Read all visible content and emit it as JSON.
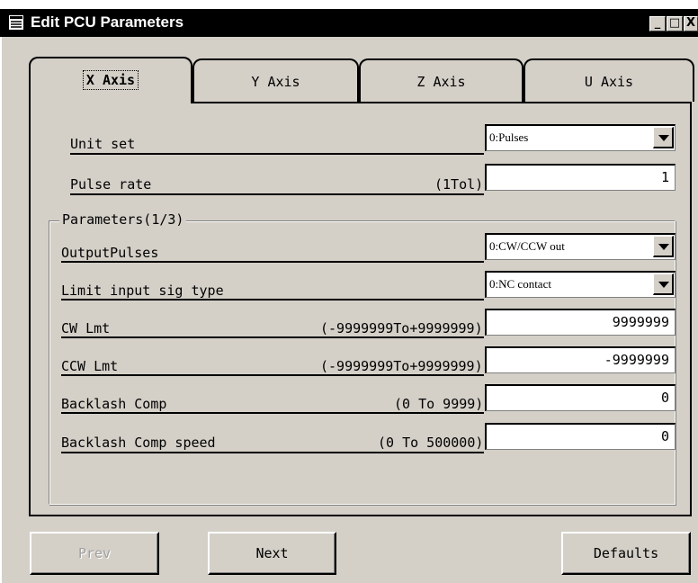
{
  "window": {
    "title": "Edit PCU Parameters",
    "minimize_glyph": "_",
    "maximize_glyph": "□",
    "close_glyph": "X"
  },
  "tabs": [
    {
      "label": "X Axis",
      "active": true
    },
    {
      "label": "Y Axis",
      "active": false
    },
    {
      "label": "Z Axis",
      "active": false
    },
    {
      "label": "U Axis",
      "active": false
    }
  ],
  "unit_set": {
    "label": "Unit set",
    "value": "0:Pulses"
  },
  "pulse_rate": {
    "label": "Pulse rate",
    "range": "(1Tol)",
    "value": "1"
  },
  "parameters": {
    "caption": "Parameters(1/3)",
    "output_pulses": {
      "label": "OutputPulses",
      "value": "0:CW/CCW out"
    },
    "limit_input": {
      "label": "Limit input sig type",
      "value": "0:NC contact"
    },
    "cw_lmt": {
      "label": "CW Lmt",
      "range": "(-9999999To+9999999)",
      "value": "9999999"
    },
    "ccw_lmt": {
      "label": "CCW Lmt",
      "range": "(-9999999To+9999999)",
      "value": "-9999999"
    },
    "backlash": {
      "label": "Backlash Comp",
      "range": "(0 To 9999)",
      "value": "0"
    },
    "backlash_speed": {
      "label": "Backlash Comp speed",
      "range": "(0 To 500000)",
      "value": "0"
    }
  },
  "buttons": {
    "prev": "Prev",
    "next": "Next",
    "defaults": "Defaults"
  },
  "colors": {
    "face": "#d4d0c8",
    "titlebar": "#000000",
    "field": "#ffffff",
    "disabled_text": "#a0a0a0"
  },
  "icons": {
    "window": "form-icon",
    "dropdown": "triangle-down-icon"
  }
}
